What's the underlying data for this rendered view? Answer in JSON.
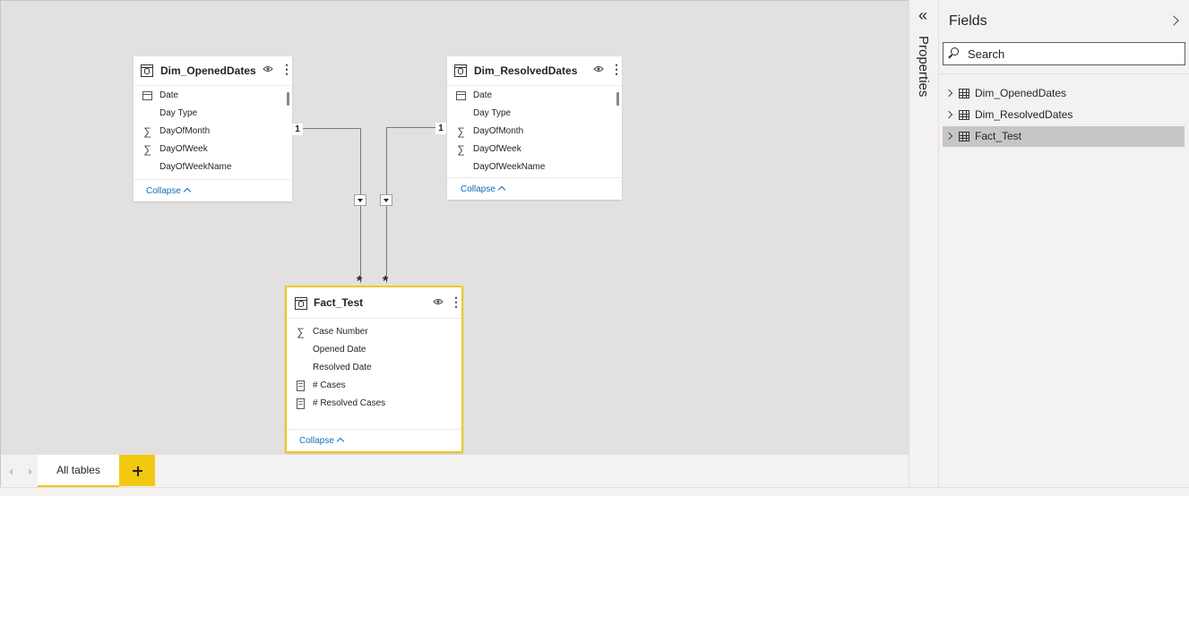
{
  "tables": {
    "dim_opened": {
      "title": "Dim_OpenedDates",
      "fields": [
        {
          "label": "Date",
          "icon": "calendar-icon"
        },
        {
          "label": "Day Type",
          "icon": ""
        },
        {
          "label": "DayOfMonth",
          "icon": "sigma-icon"
        },
        {
          "label": "DayOfWeek",
          "icon": "sigma-icon"
        },
        {
          "label": "DayOfWeekName",
          "icon": ""
        }
      ],
      "collapse_label": "Collapse"
    },
    "dim_resolved": {
      "title": "Dim_ResolvedDates",
      "fields": [
        {
          "label": "Date",
          "icon": "calendar-icon"
        },
        {
          "label": "Day Type",
          "icon": ""
        },
        {
          "label": "DayOfMonth",
          "icon": "sigma-icon"
        },
        {
          "label": "DayOfWeek",
          "icon": "sigma-icon"
        },
        {
          "label": "DayOfWeekName",
          "icon": ""
        }
      ],
      "collapse_label": "Collapse"
    },
    "fact_test": {
      "title": "Fact_Test",
      "fields": [
        {
          "label": "Case Number",
          "icon": "sigma-icon"
        },
        {
          "label": "Opened Date",
          "icon": ""
        },
        {
          "label": "Resolved Date",
          "icon": ""
        },
        {
          "label": "# Cases",
          "icon": "calculator-icon"
        },
        {
          "label": "# Resolved Cases",
          "icon": "calculator-icon"
        }
      ],
      "collapse_label": "Collapse"
    }
  },
  "relationships": {
    "one_label": "1",
    "many_label": "*"
  },
  "tabs": {
    "all_tables": "All tables"
  },
  "properties_panel": {
    "label": "Properties"
  },
  "fields_panel": {
    "title": "Fields",
    "search_placeholder": "Search",
    "items": [
      {
        "label": "Dim_OpenedDates",
        "selected": false
      },
      {
        "label": "Dim_ResolvedDates",
        "selected": false
      },
      {
        "label": "Fact_Test",
        "selected": true
      }
    ]
  },
  "colors": {
    "accent": "#f2c811",
    "link": "#0f6cbd",
    "canvas": "#e2e1df"
  }
}
